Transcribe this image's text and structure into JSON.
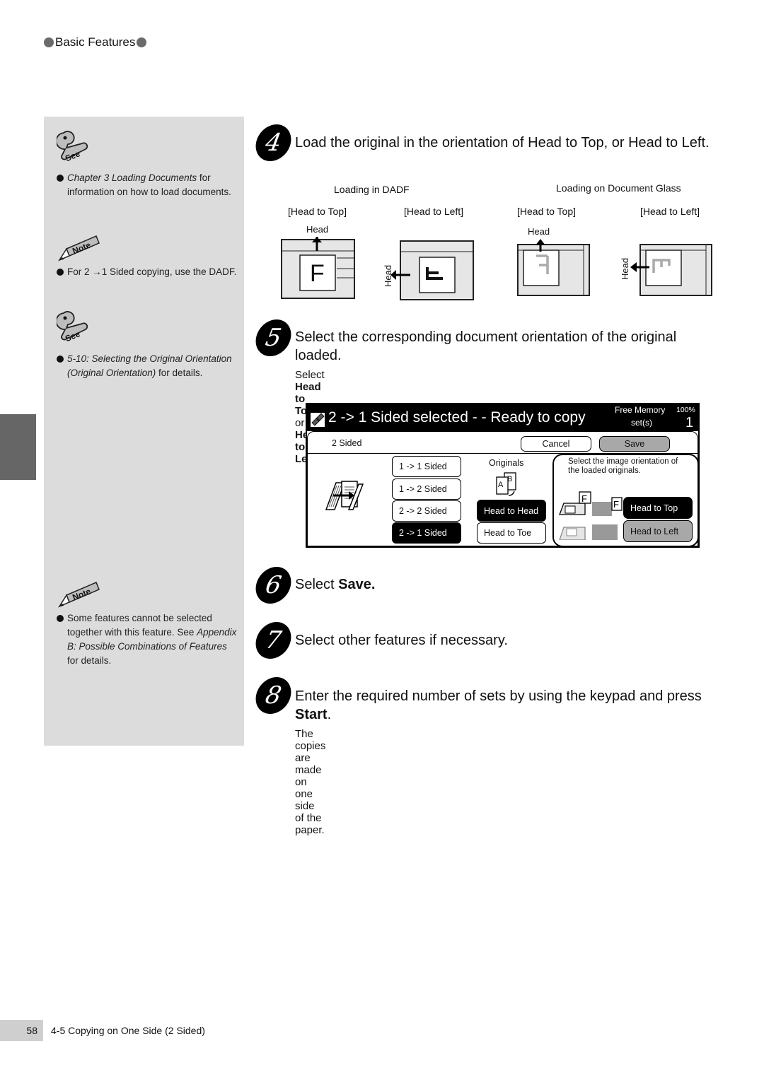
{
  "header": {
    "section": "Basic Features"
  },
  "sidebar": {
    "refs": [
      {
        "type": "see",
        "icon_label": "See",
        "italic": "Chapter 3 Loading Documents",
        "text": " for information on how to load documents."
      },
      {
        "type": "note",
        "icon_label": "Note",
        "text_before": "For 2",
        "arrow": "→",
        "text_after": "1 Sided copying, use the DADF."
      },
      {
        "type": "see",
        "icon_label": "See",
        "italic": "5-10: Selecting the Original Orientation (Original Orientation)",
        "text": " for details."
      },
      {
        "type": "note",
        "icon_label": "Note",
        "text": "Some features cannot be selected together with this feature. See ",
        "italic": "Appendix B: Possible Combinations of Features",
        "text_after": " for details."
      }
    ]
  },
  "steps": [
    {
      "number": "4",
      "text": "Load the original in the orientation of Head to Top, or Head to Left."
    },
    {
      "number": "5",
      "text": "Select the corresponding document orientation of the original loaded.",
      "sub_prefix": "Select ",
      "sub_bold1": "Head to Top",
      "sub_mid": " or ",
      "sub_bold2": "Head to Left",
      "sub_suffix": "."
    },
    {
      "number": "6",
      "prefix": "Select ",
      "bold": "Save."
    },
    {
      "number": "7",
      "text": "Select other features if necessary."
    },
    {
      "number": "8",
      "prefix": "Enter the required number of sets by using the keypad and press ",
      "bold": "Start",
      "suffix": ".",
      "sub": "The copies are made on one side of the paper."
    }
  ],
  "loading": {
    "dadf_title": "Loading in DADF",
    "glass_title": "Loading on Document Glass",
    "head_to_top": "[Head to Top]",
    "head_to_left": "[Head to Left]",
    "head": "Head",
    "letter": "F"
  },
  "touch_panel": {
    "title": "2 -> 1 Sided selected - - Ready to copy",
    "free_memory_label": "Free Memory",
    "free_memory_value": "100%",
    "sets_label": "set(s)",
    "sets_value": "1",
    "tab": "2 Sided",
    "cancel": "Cancel",
    "save": "Save",
    "sided_options": [
      {
        "label": "1 -> 1 Sided",
        "selected": false
      },
      {
        "label": "1 -> 2 Sided",
        "selected": false
      },
      {
        "label": "2 -> 2 Sided",
        "selected": false
      },
      {
        "label": "2 -> 1 Sided",
        "selected": true
      }
    ],
    "originals_label": "Originals",
    "originals_options": [
      {
        "label": "Head to Head",
        "selected": true
      },
      {
        "label": "Head to Toe",
        "selected": false
      }
    ],
    "orientation_prompt": "Select the image orientation of the loaded originals.",
    "orientation_options": [
      {
        "label": "Head to Top",
        "selected": true
      },
      {
        "label": "Head to Left",
        "selected": false
      }
    ]
  },
  "footer": {
    "page": "58",
    "section": "4-5  Copying on One Side (2 Sided)"
  }
}
